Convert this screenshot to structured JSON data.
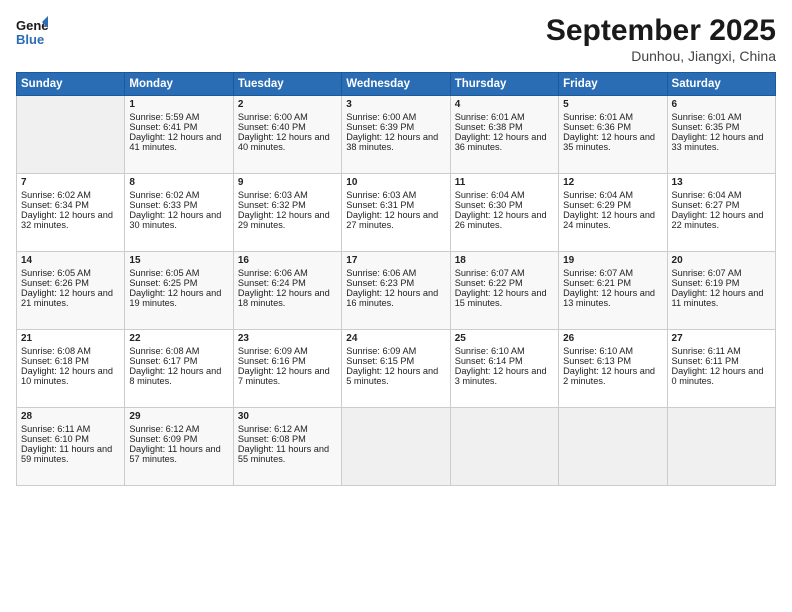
{
  "logo": {
    "line1": "General",
    "line2": "Blue"
  },
  "title": "September 2025",
  "location": "Dunhou, Jiangxi, China",
  "days_header": [
    "Sunday",
    "Monday",
    "Tuesday",
    "Wednesday",
    "Thursday",
    "Friday",
    "Saturday"
  ],
  "weeks": [
    [
      {
        "day": "",
        "sunrise": "",
        "sunset": "",
        "daylight": ""
      },
      {
        "day": "1",
        "sunrise": "Sunrise: 5:59 AM",
        "sunset": "Sunset: 6:41 PM",
        "daylight": "Daylight: 12 hours and 41 minutes."
      },
      {
        "day": "2",
        "sunrise": "Sunrise: 6:00 AM",
        "sunset": "Sunset: 6:40 PM",
        "daylight": "Daylight: 12 hours and 40 minutes."
      },
      {
        "day": "3",
        "sunrise": "Sunrise: 6:00 AM",
        "sunset": "Sunset: 6:39 PM",
        "daylight": "Daylight: 12 hours and 38 minutes."
      },
      {
        "day": "4",
        "sunrise": "Sunrise: 6:01 AM",
        "sunset": "Sunset: 6:38 PM",
        "daylight": "Daylight: 12 hours and 36 minutes."
      },
      {
        "day": "5",
        "sunrise": "Sunrise: 6:01 AM",
        "sunset": "Sunset: 6:36 PM",
        "daylight": "Daylight: 12 hours and 35 minutes."
      },
      {
        "day": "6",
        "sunrise": "Sunrise: 6:01 AM",
        "sunset": "Sunset: 6:35 PM",
        "daylight": "Daylight: 12 hours and 33 minutes."
      }
    ],
    [
      {
        "day": "7",
        "sunrise": "Sunrise: 6:02 AM",
        "sunset": "Sunset: 6:34 PM",
        "daylight": "Daylight: 12 hours and 32 minutes."
      },
      {
        "day": "8",
        "sunrise": "Sunrise: 6:02 AM",
        "sunset": "Sunset: 6:33 PM",
        "daylight": "Daylight: 12 hours and 30 minutes."
      },
      {
        "day": "9",
        "sunrise": "Sunrise: 6:03 AM",
        "sunset": "Sunset: 6:32 PM",
        "daylight": "Daylight: 12 hours and 29 minutes."
      },
      {
        "day": "10",
        "sunrise": "Sunrise: 6:03 AM",
        "sunset": "Sunset: 6:31 PM",
        "daylight": "Daylight: 12 hours and 27 minutes."
      },
      {
        "day": "11",
        "sunrise": "Sunrise: 6:04 AM",
        "sunset": "Sunset: 6:30 PM",
        "daylight": "Daylight: 12 hours and 26 minutes."
      },
      {
        "day": "12",
        "sunrise": "Sunrise: 6:04 AM",
        "sunset": "Sunset: 6:29 PM",
        "daylight": "Daylight: 12 hours and 24 minutes."
      },
      {
        "day": "13",
        "sunrise": "Sunrise: 6:04 AM",
        "sunset": "Sunset: 6:27 PM",
        "daylight": "Daylight: 12 hours and 22 minutes."
      }
    ],
    [
      {
        "day": "14",
        "sunrise": "Sunrise: 6:05 AM",
        "sunset": "Sunset: 6:26 PM",
        "daylight": "Daylight: 12 hours and 21 minutes."
      },
      {
        "day": "15",
        "sunrise": "Sunrise: 6:05 AM",
        "sunset": "Sunset: 6:25 PM",
        "daylight": "Daylight: 12 hours and 19 minutes."
      },
      {
        "day": "16",
        "sunrise": "Sunrise: 6:06 AM",
        "sunset": "Sunset: 6:24 PM",
        "daylight": "Daylight: 12 hours and 18 minutes."
      },
      {
        "day": "17",
        "sunrise": "Sunrise: 6:06 AM",
        "sunset": "Sunset: 6:23 PM",
        "daylight": "Daylight: 12 hours and 16 minutes."
      },
      {
        "day": "18",
        "sunrise": "Sunrise: 6:07 AM",
        "sunset": "Sunset: 6:22 PM",
        "daylight": "Daylight: 12 hours and 15 minutes."
      },
      {
        "day": "19",
        "sunrise": "Sunrise: 6:07 AM",
        "sunset": "Sunset: 6:21 PM",
        "daylight": "Daylight: 12 hours and 13 minutes."
      },
      {
        "day": "20",
        "sunrise": "Sunrise: 6:07 AM",
        "sunset": "Sunset: 6:19 PM",
        "daylight": "Daylight: 12 hours and 11 minutes."
      }
    ],
    [
      {
        "day": "21",
        "sunrise": "Sunrise: 6:08 AM",
        "sunset": "Sunset: 6:18 PM",
        "daylight": "Daylight: 12 hours and 10 minutes."
      },
      {
        "day": "22",
        "sunrise": "Sunrise: 6:08 AM",
        "sunset": "Sunset: 6:17 PM",
        "daylight": "Daylight: 12 hours and 8 minutes."
      },
      {
        "day": "23",
        "sunrise": "Sunrise: 6:09 AM",
        "sunset": "Sunset: 6:16 PM",
        "daylight": "Daylight: 12 hours and 7 minutes."
      },
      {
        "day": "24",
        "sunrise": "Sunrise: 6:09 AM",
        "sunset": "Sunset: 6:15 PM",
        "daylight": "Daylight: 12 hours and 5 minutes."
      },
      {
        "day": "25",
        "sunrise": "Sunrise: 6:10 AM",
        "sunset": "Sunset: 6:14 PM",
        "daylight": "Daylight: 12 hours and 3 minutes."
      },
      {
        "day": "26",
        "sunrise": "Sunrise: 6:10 AM",
        "sunset": "Sunset: 6:13 PM",
        "daylight": "Daylight: 12 hours and 2 minutes."
      },
      {
        "day": "27",
        "sunrise": "Sunrise: 6:11 AM",
        "sunset": "Sunset: 6:11 PM",
        "daylight": "Daylight: 12 hours and 0 minutes."
      }
    ],
    [
      {
        "day": "28",
        "sunrise": "Sunrise: 6:11 AM",
        "sunset": "Sunset: 6:10 PM",
        "daylight": "Daylight: 11 hours and 59 minutes."
      },
      {
        "day": "29",
        "sunrise": "Sunrise: 6:12 AM",
        "sunset": "Sunset: 6:09 PM",
        "daylight": "Daylight: 11 hours and 57 minutes."
      },
      {
        "day": "30",
        "sunrise": "Sunrise: 6:12 AM",
        "sunset": "Sunset: 6:08 PM",
        "daylight": "Daylight: 11 hours and 55 minutes."
      },
      {
        "day": "",
        "sunrise": "",
        "sunset": "",
        "daylight": ""
      },
      {
        "day": "",
        "sunrise": "",
        "sunset": "",
        "daylight": ""
      },
      {
        "day": "",
        "sunrise": "",
        "sunset": "",
        "daylight": ""
      },
      {
        "day": "",
        "sunrise": "",
        "sunset": "",
        "daylight": ""
      }
    ]
  ]
}
